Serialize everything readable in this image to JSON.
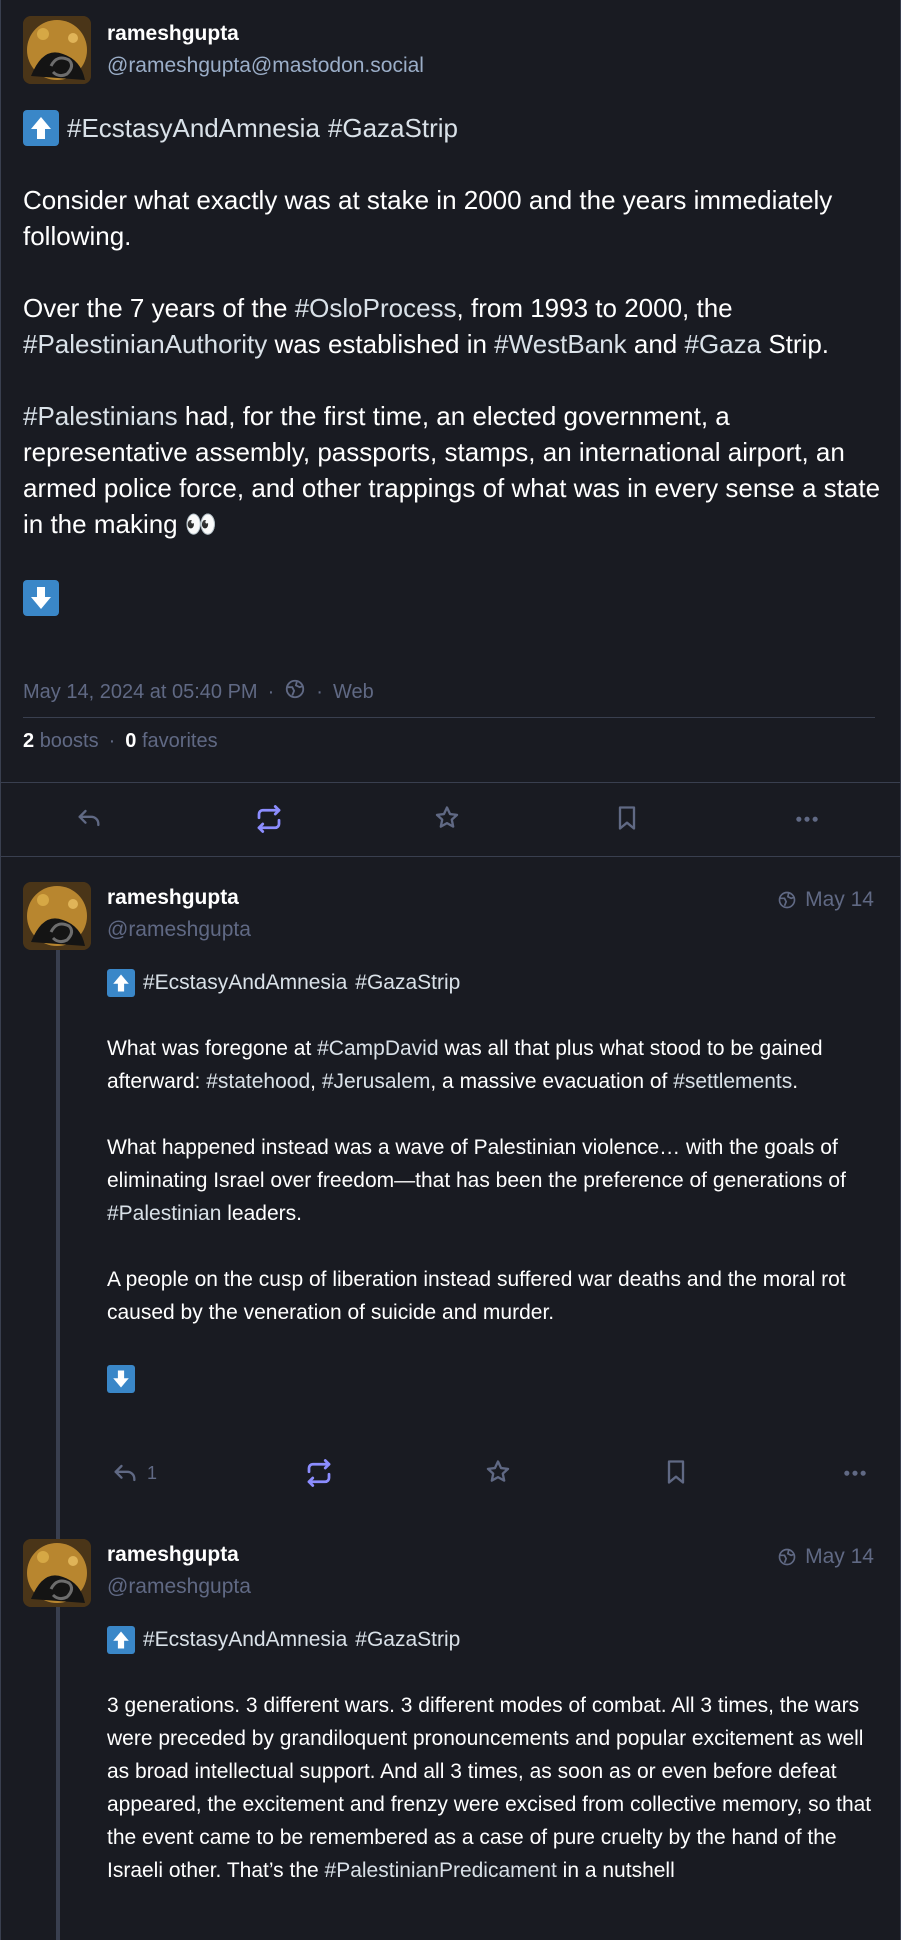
{
  "focused": {
    "display_name": "rameshgupta",
    "handle": "@rameshgupta@mastodon.social",
    "tags_line": [
      "#EcstasyAndAmnesia",
      "#GazaStrip"
    ],
    "p1": "Consider what exactly was at stake in 2000 and the years immediately following.",
    "p2": {
      "a": "Over the 7 years of the ",
      "t1": "#OsloProcess",
      "b": ", from 1993 to 2000, the ",
      "t2": "#PalestinianAuthority",
      "c": " was established in ",
      "t3": "#WestBank",
      "d": " and ",
      "t4": "#Gaza",
      "e": " Strip."
    },
    "p3": {
      "t1": "#Palestinians",
      "a": " had, for the first time, an elected government, a representative assembly, passports, stamps, an international airport, an armed police force, and other trappings of what was in every sense a state in the making 👀"
    },
    "timestamp": "May 14, 2024 at 05:40 PM",
    "sep": "·",
    "app": "Web",
    "boosts_count": "2",
    "boosts_label": "boosts",
    "favorites_count": "0",
    "favorites_label": "favorites"
  },
  "replies": [
    {
      "display_name": "rameshgupta",
      "handle": "@rameshgupta",
      "time": "May 14",
      "tags_line": [
        "#EcstasyAndAmnesia",
        "#GazaStrip"
      ],
      "p1": {
        "a": "What was foregone at ",
        "t1": "#CampDavid",
        "b": " was all that plus what stood to be gained afterward: ",
        "t2": "#statehood",
        "c": ", ",
        "t3": "#Jerusalem",
        "d": ", a massive evacuation of ",
        "t4": "#settlements",
        "e": "."
      },
      "p2": {
        "a": "What happened instead was a wave of Palestinian violence… with the goals of eliminating Israel over freedom—that has been the preference of generations of ",
        "t1": "#Palestinian",
        "b": " leaders."
      },
      "p3": "A people on the cusp of liberation instead suffered war deaths and the moral rot caused by the veneration of suicide and murder.",
      "reply_count": "1"
    },
    {
      "display_name": "rameshgupta",
      "handle": "@rameshgupta",
      "time": "May 14",
      "tags_line": [
        "#EcstasyAndAmnesia",
        "#GazaStrip"
      ],
      "p1": {
        "a": "3 generations. 3 different wars. 3 different modes of combat. All 3 times, the wars were preceded by grandiloquent pronouncements and popular excitement as well as broad intellectual support. And all 3 times, as soon as or even before defeat appeared, the excitement and frenzy were excised from collective memory, so that the event came to be remembered as a case of pure cruelty by the hand of the Israeli other. That’s the ",
        "t1": "#PalestinianPredicament",
        "b": " in a nutshell"
      }
    }
  ],
  "colors": {
    "background": "#191b22",
    "muted": "#606984",
    "handle": "#9baec8",
    "boost_active": "#8c8dff",
    "emoji_blue": "#3a87c8"
  },
  "icons": [
    "reply-icon",
    "boost-icon",
    "star-icon",
    "bookmark-icon",
    "more-icon",
    "globe-icon",
    "arrow-up-emoji",
    "arrow-down-emoji"
  ]
}
